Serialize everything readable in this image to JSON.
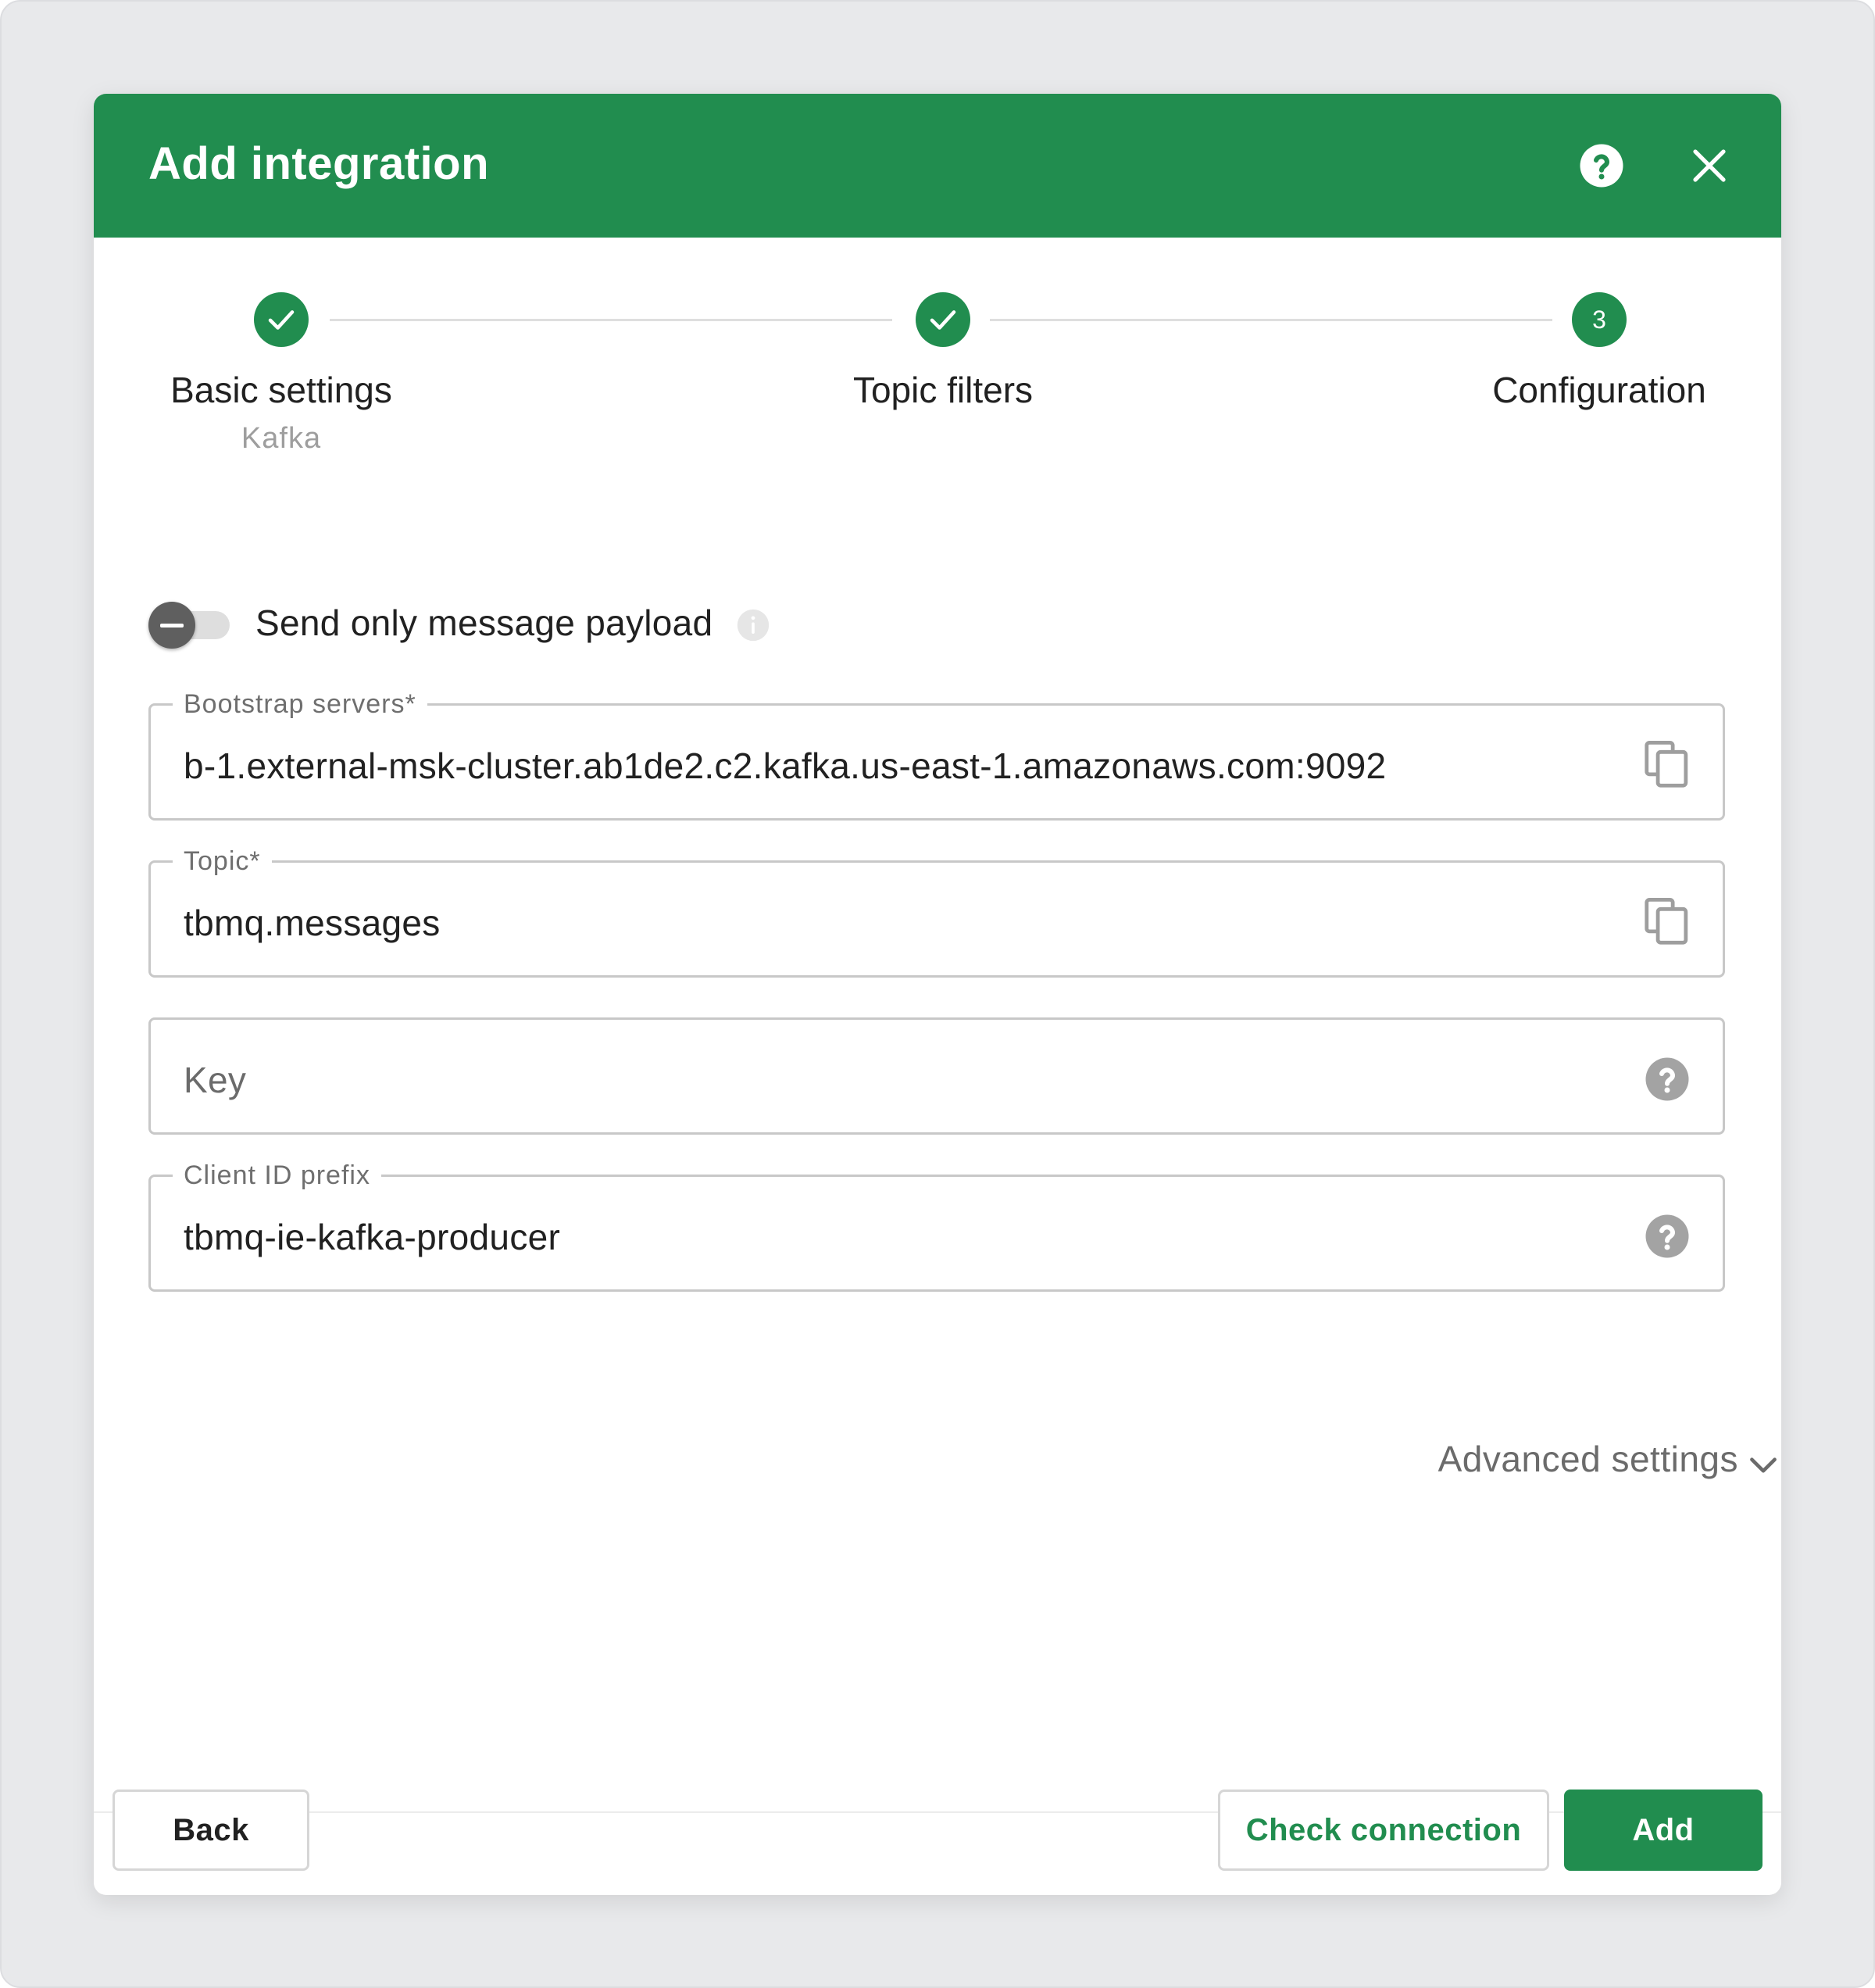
{
  "dialog": {
    "title": "Add integration",
    "help_icon": "help-circle-icon",
    "close_icon": "close-icon"
  },
  "stepper": {
    "steps": [
      {
        "label": "Basic settings",
        "sublabel": "Kafka",
        "state": "completed"
      },
      {
        "label": "Topic filters",
        "sublabel": "",
        "state": "completed"
      },
      {
        "label": "Configuration",
        "sublabel": "",
        "state": "active",
        "number": "3"
      }
    ]
  },
  "payload_toggle": {
    "label": "Send only message payload",
    "checked": false
  },
  "fields": {
    "bootstrap": {
      "label": "Bootstrap servers*",
      "value": "b-1.external-msk-cluster.ab1de2.c2.kafka.us-east-1.amazonaws.com:9092",
      "icon": "copy-icon"
    },
    "topic": {
      "label": "Topic*",
      "value": "tbmq.messages",
      "icon": "copy-icon"
    },
    "key": {
      "placeholder": "Key",
      "icon": "help-circle-icon"
    },
    "client_id": {
      "label": "Client ID prefix",
      "value": "tbmq-ie-kafka-producer",
      "icon": "help-circle-icon"
    }
  },
  "advanced": {
    "label": "Advanced settings",
    "icon": "chevron-down-icon"
  },
  "footer": {
    "back_label": "Back",
    "check_label": "Check connection",
    "add_label": "Add"
  },
  "colors": {
    "brand_green": "#218d4f",
    "backdrop": "#e8e9eb"
  }
}
